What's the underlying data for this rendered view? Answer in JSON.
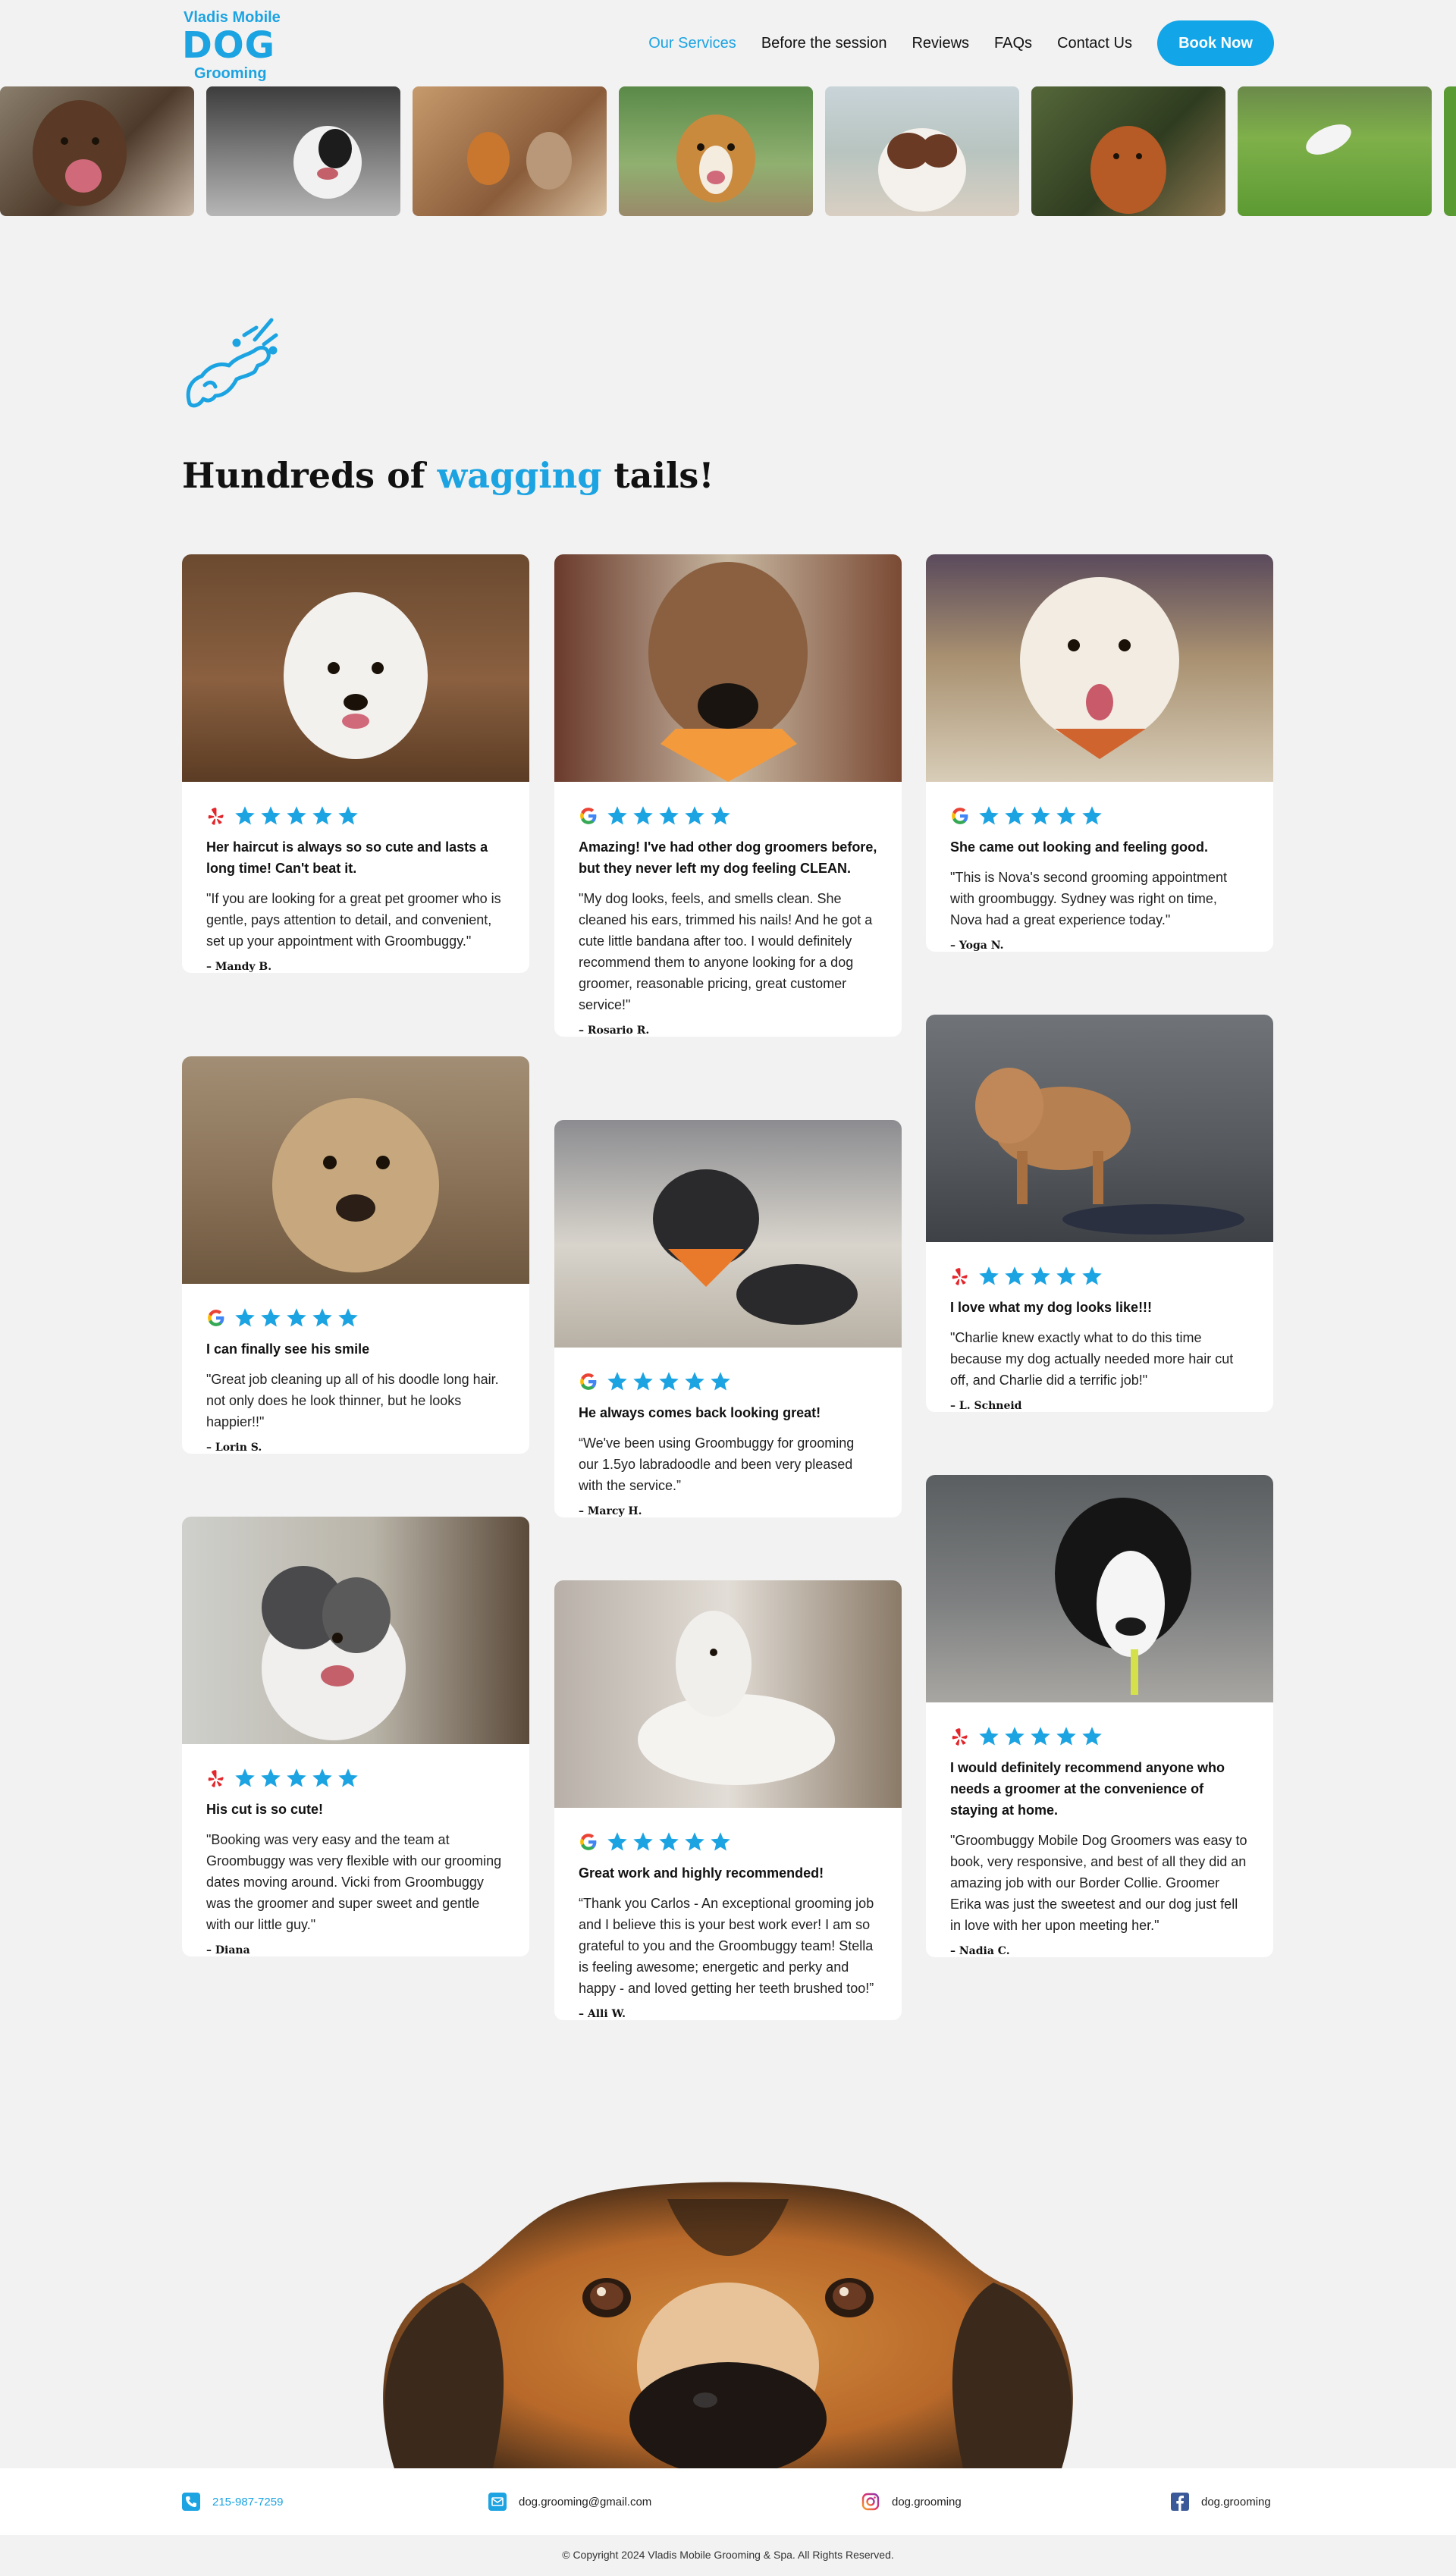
{
  "header": {
    "logo": {
      "line1": "Vladis Mobile",
      "line2": "DOG",
      "line3": "Grooming"
    },
    "nav": [
      "Our Services",
      "Before the session",
      "Reviews",
      "FAQs",
      "Contact Us"
    ],
    "book_label": "Book Now",
    "accent": "#1ba3e2"
  },
  "strip": [
    {
      "icon": "dog-photo-chocolate-lab"
    },
    {
      "icon": "dog-photo-boston-terrier"
    },
    {
      "icon": "dog-photo-corgi-pair"
    },
    {
      "icon": "dog-photo-beagle"
    },
    {
      "icon": "dog-photo-aussie"
    },
    {
      "icon": "dog-photo-golden"
    },
    {
      "icon": "dog-photo-jumping"
    }
  ],
  "heading": {
    "before": "Hundreds of ",
    "accent": "wagging",
    "after": " tails!"
  },
  "reviews": [
    {
      "source": "yelp",
      "stars": 5,
      "title": "Her haircut is always so so cute and lasts a long time! Can't beat it.",
      "quote": "\"If you are looking for a great pet groomer who is gentle, pays attention to detail, and convenient, set up your appointment with Groombuggy.\"",
      "author": "– Mandy B."
    },
    {
      "source": "google",
      "stars": 5,
      "title": "I can finally see his smile",
      "quote": "\"Great job cleaning up all of his doodle long hair. not only does he look thinner, but he looks happier!!\"",
      "author": "– Lorin S."
    },
    {
      "source": "yelp",
      "stars": 5,
      "title": "His cut is so cute!",
      "quote": "\"Booking was very easy and the team at Groombuggy was very flexible with our grooming dates moving around. Vicki from Groombuggy was the groomer and super sweet and gentle with our little guy.\"",
      "author": "– Diana"
    },
    {
      "source": "google",
      "stars": 5,
      "title": "Amazing! I've had other dog groomers before, but they never left my dog feeling CLEAN.",
      "quote": "\"My dog looks, feels, and smells clean. She cleaned his ears, trimmed his nails! And he got a cute little bandana after too. I would definitely recommend them to anyone looking for a dog groomer, reasonable pricing, great customer service!\"",
      "author": "– Rosario R."
    },
    {
      "source": "google",
      "stars": 5,
      "title": "He always comes back looking great!",
      "quote": "“We've been using Groombuggy for grooming our 1.5yo labradoodle and been very pleased with the service.”",
      "author": "– Marcy H."
    },
    {
      "source": "google",
      "stars": 5,
      "title": "Great work and highly recommended!",
      "quote": "“Thank you Carlos - An exceptional grooming job and I believe this is your best work ever! I am so grateful to you and the Groombuggy team! Stella is feeling awesome; energetic and perky and happy - and loved getting her teeth brushed too!”",
      "author": "– Alli W."
    },
    {
      "source": "google",
      "stars": 5,
      "title": "She came out looking and feeling good.",
      "quote": "\"This is Nova's second grooming appointment with groombuggy. Sydney was right on time, Nova had a great experience today.\"",
      "author": "– Yoga N."
    },
    {
      "source": "yelp",
      "stars": 5,
      "title": "I love what my dog looks like!!!",
      "quote": "\"Charlie knew exactly what to do this time because my dog actually needed more hair cut off, and Charlie did a terrific job!\"",
      "author": "– L. Schneid"
    },
    {
      "source": "yelp",
      "stars": 5,
      "title": "I would definitely recommend anyone who needs a groomer at the convenience of staying at home.",
      "quote": "\"Groombuggy Mobile Dog Groomers was easy to book, very responsive, and best of all they did an amazing job with our Border Collie. Groomer Erika was just the sweetest and our dog just fell in love with her upon meeting her.\"",
      "author": "– Nadia C."
    }
  ],
  "footer": {
    "phone": "215-987-7259",
    "email": "dog.grooming@gmail.com",
    "instagram": "dog.grooming",
    "facebook": "dog.grooming",
    "copyright": "© Copyright 2024 Vladis Mobile Grooming & Spa. All Rights Reserved."
  },
  "colors": {
    "star": "#1ba3e2",
    "yelp": "#e3262b",
    "background": "#f2f2f2"
  }
}
